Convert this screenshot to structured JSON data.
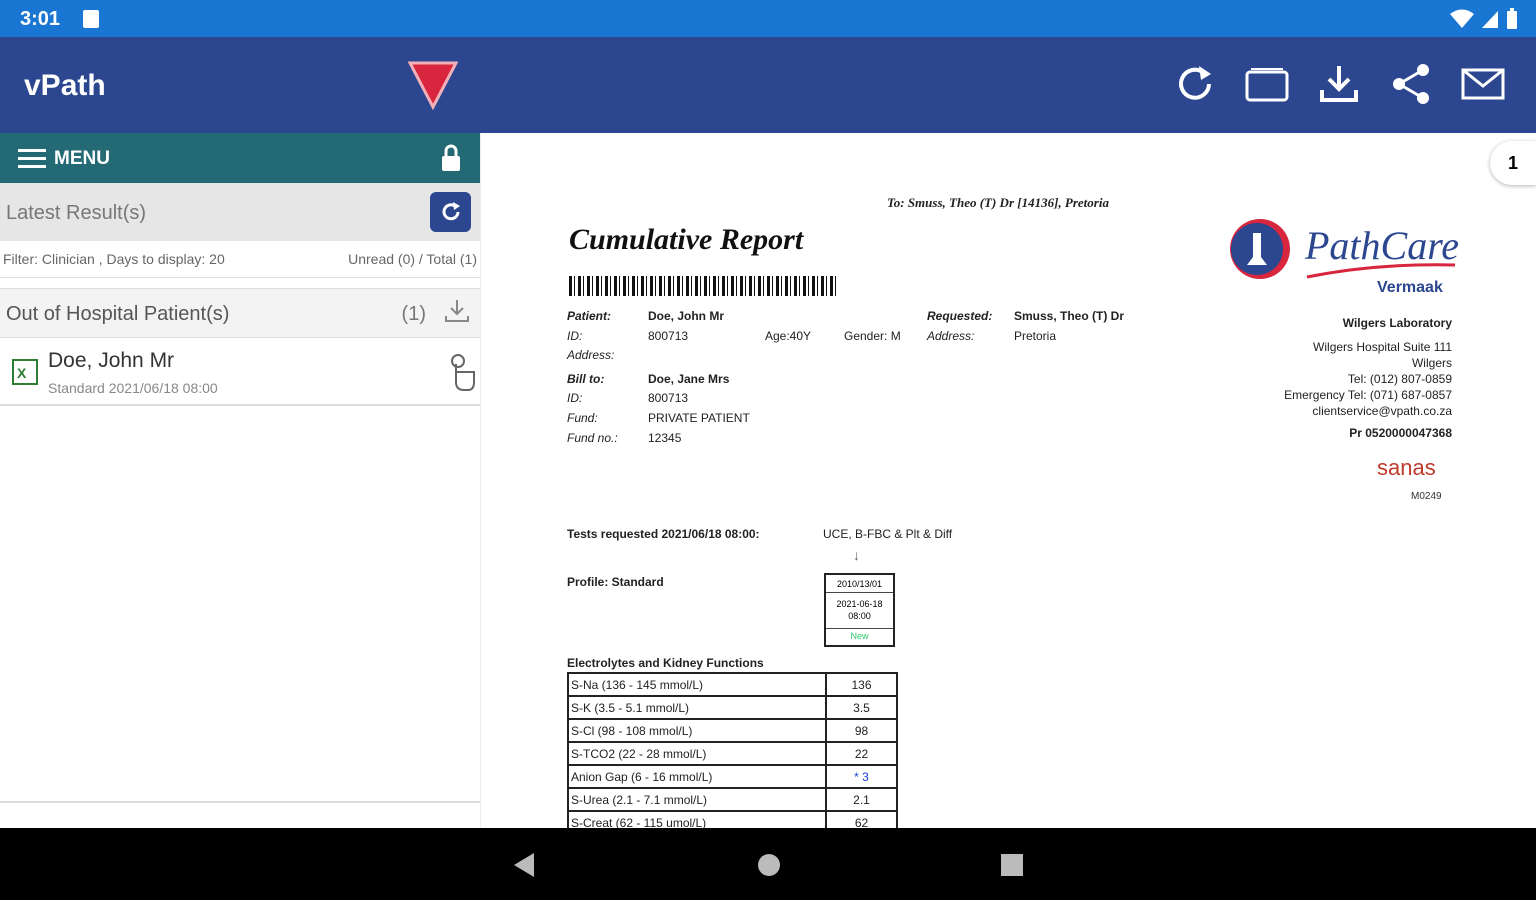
{
  "status": {
    "time": "3:01"
  },
  "app": {
    "title": "vPath"
  },
  "menu": {
    "label": "MENU"
  },
  "latest": {
    "label": "Latest Result(s)"
  },
  "filter": {
    "text": "Filter: Clinician , Days to display: 20",
    "counts": "Unread (0)  / Total (1)"
  },
  "group": {
    "label": "Out of Hospital Patient(s)",
    "count": "(1)"
  },
  "patient": {
    "name": "Doe, John Mr",
    "sub": "Standard 2021/06/18 08:00"
  },
  "report": {
    "page": "1",
    "to": "To: Smuss, Theo (T) Dr [14136], Pretoria",
    "title": "Cumulative Report",
    "brand": "PathCare",
    "brand_sub": "Vermaak",
    "patient_label": "Patient:",
    "patient_name": "Doe, John Mr",
    "id_label": "ID:",
    "id_value": "800713",
    "age": "Age:40Y",
    "gender": "Gender: M",
    "address_label": "Address:",
    "requested_label": "Requested:",
    "requested_value": "Smuss, Theo (T) Dr",
    "req_address_label": "Address:",
    "req_address_value": "Pretoria",
    "billto_label": "Bill to:",
    "billto_name": "Doe, Jane Mrs",
    "bill_id_label": "ID:",
    "bill_id_value": "800713",
    "fund_label": "Fund:",
    "fund_value": "PRIVATE PATIENT",
    "fundno_label": "Fund no.:",
    "fundno_value": "12345",
    "lab_name": "Wilgers Laboratory",
    "lab_addr1": "Wilgers Hospital Suite 111",
    "lab_addr2": "Wilgers",
    "lab_tel": "Tel: (012) 807-0859",
    "lab_emerg": "Emergency Tel: (071) 687-0857",
    "lab_email": "clientservice@vpath.co.za",
    "lab_pr": "Pr 0520000047368",
    "sanas": "sanas",
    "sanas_num": "M0249",
    "tests_label": "Tests requested 2021/06/18 08:00:",
    "tests_value": "UCE, B-FBC & Plt & Diff",
    "profile_label": "Profile: Standard",
    "date_box_1": "2010/13/01",
    "date_box_2": "2021-06-18 08:00",
    "date_box_3": "New",
    "section": "Electrolytes and Kidney Functions",
    "rows": [
      {
        "name": "S-Na (136 - 145 mmol/L)",
        "value": "136"
      },
      {
        "name": "S-K (3.5 - 5.1 mmol/L)",
        "value": "3.5"
      },
      {
        "name": "S-Cl (98 - 108 mmol/L)",
        "value": "98"
      },
      {
        "name": "S-TCO2 (22 - 28 mmol/L)",
        "value": "22"
      },
      {
        "name": "Anion Gap (6 - 16 mmol/L)",
        "value": "* 3"
      },
      {
        "name": "S-Urea (2.1 - 7.1 mmol/L)",
        "value": "2.1"
      },
      {
        "name": "S-Creat (62 - 115 umol/L)",
        "value": "62"
      }
    ]
  },
  "colors": {
    "statusbar": "#1976d2",
    "appbar": "#2c4790",
    "menubar": "#236a74",
    "accent_red": "#d7263d"
  }
}
